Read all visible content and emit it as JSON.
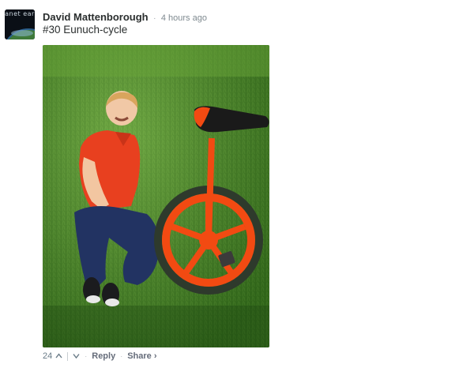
{
  "post": {
    "avatar_text": "anet ear",
    "author": "David Mattenborough",
    "separator": "·",
    "timestamp": "4 hours ago",
    "comment_text": "#30 Eunuch-cycle"
  },
  "actions": {
    "vote_count": "24",
    "reply_label": "Reply",
    "share_label": "Share ›"
  },
  "icons": {
    "upvote": "chevron-up-icon",
    "downvote": "chevron-down-icon"
  },
  "colors": {
    "grass": "#3e7a22",
    "unicycle": "#f24a12",
    "shirt": "#e8401f",
    "jeans": "#1f2f5c",
    "link": "#656c7a"
  }
}
